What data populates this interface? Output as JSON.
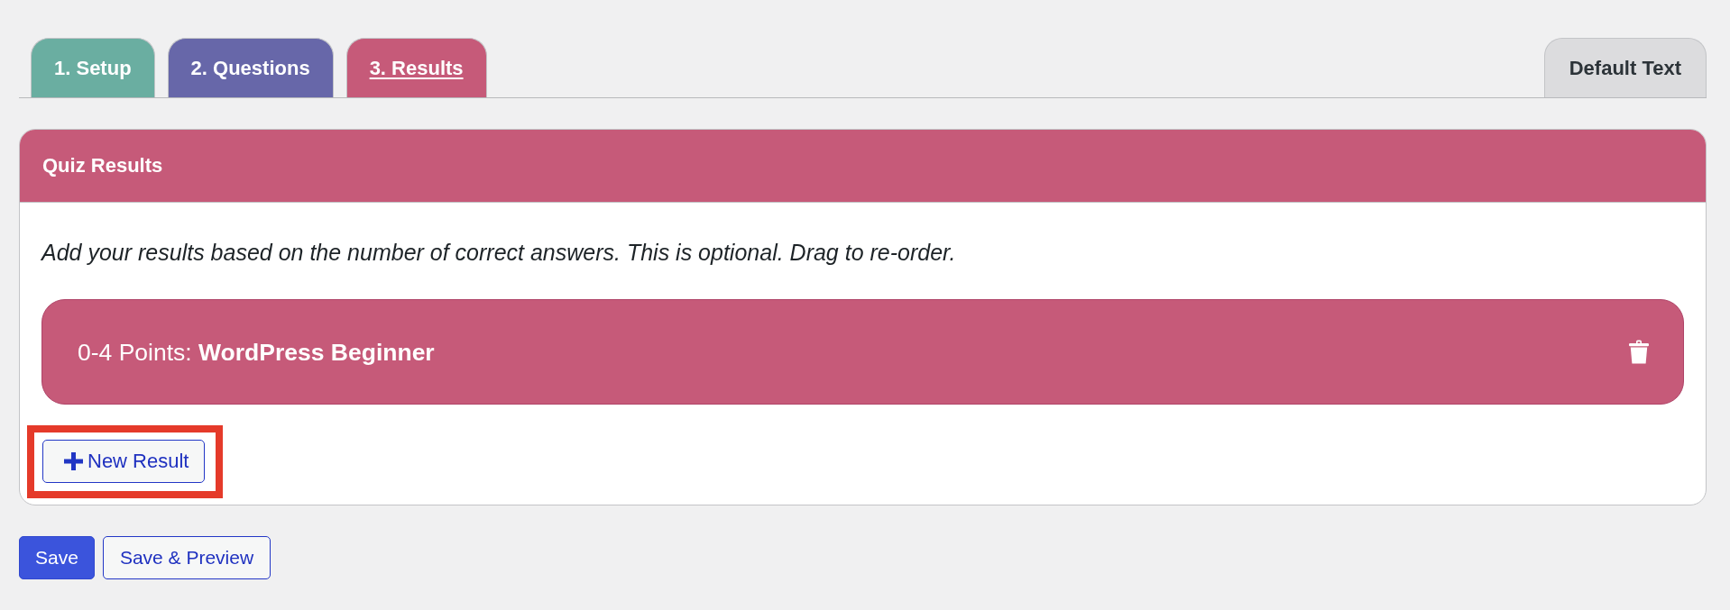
{
  "tabs": [
    {
      "label": "1. Setup",
      "color": "#6aaea1",
      "selected": false
    },
    {
      "label": "2. Questions",
      "color": "#6767a9",
      "selected": false
    },
    {
      "label": "3. Results",
      "color": "#c65a79",
      "selected": true
    }
  ],
  "side_tab": {
    "label": "Default Text",
    "selected": false
  },
  "panel": {
    "title": "Quiz Results",
    "description": "Add your results based on the number of correct answers. This is optional. Drag to re-order.",
    "results": [
      {
        "label": "0-4 Points: **WordPress Beginner**"
      }
    ],
    "add_button": {
      "label": "New Result",
      "highlighted": true
    }
  },
  "actions": [
    {
      "label": "Save",
      "kind": "primary"
    },
    {
      "label": "Save & Preview",
      "kind": "secondary"
    }
  ]
}
